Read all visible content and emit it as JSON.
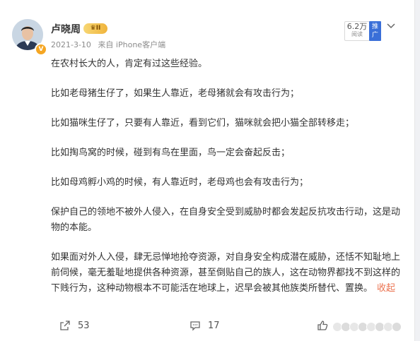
{
  "post": {
    "author": "卢晓周",
    "vip_label": "II",
    "date": "2021-3-10",
    "source": "来自 iPhone客户端",
    "read_count": "6.2万",
    "read_label": "阅读",
    "promote_label": "推广",
    "paragraphs": [
      "在农村长大的人，肯定有过这些经验。",
      "比如老母猪生仔了，如果生人靠近，老母猪就会有攻击行为；",
      "比如猫咪生仔了，只要有人靠近，看到它们，猫咪就会把小猫全部转移走；",
      "比如掏鸟窝的时候，碰到有鸟在里面，鸟一定会奋起反击；",
      "比如母鸡孵小鸡的时候，有人靠近时，老母鸡也会有攻击行为；",
      "保护自己的领地不被外人侵入，在自身安全受到威胁时都会发起反抗攻击行动，这是动物的本能。",
      "如果面对外人入侵，肆无忌惮地抢夺资源，对自身安全构成潜在威胁，还恬不知耻地上前伺候，毫无羞耻地提供各种资源，甚至倒贴自己的族人，这在动物界都找不到这样的下贱行为，这种动物根本不可能活在地球上，迟早会被其他族类所替代、置换。"
    ],
    "collapse_label": "收起"
  },
  "footer": {
    "repost_count": "53",
    "comment_count": "17"
  },
  "colors": {
    "accent_orange": "#eb7350",
    "promote_blue": "#3a6fd8"
  }
}
